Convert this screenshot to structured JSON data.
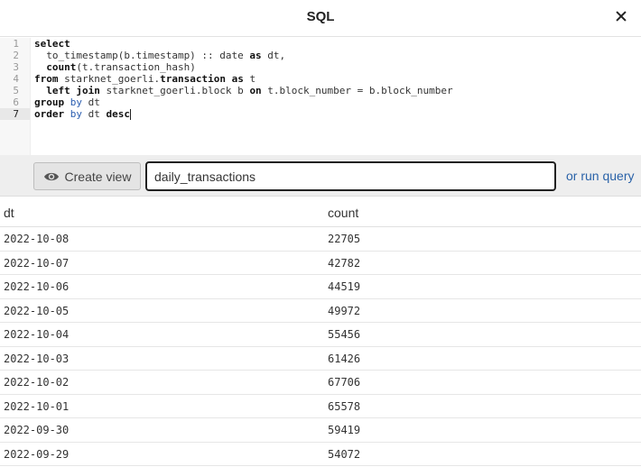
{
  "dialog": {
    "title": "SQL"
  },
  "editor": {
    "line_numbers": [
      "1",
      "2",
      "3",
      "4",
      "5",
      "6",
      "7"
    ],
    "active_line": 7
  },
  "toolbar": {
    "create_view_label": "Create view",
    "view_name_value": "daily_transactions",
    "run_query_label": "or run query"
  },
  "results": {
    "columns": [
      "dt",
      "count"
    ],
    "rows": [
      [
        "2022-10-08",
        "22705"
      ],
      [
        "2022-10-07",
        "42782"
      ],
      [
        "2022-10-06",
        "44519"
      ],
      [
        "2022-10-05",
        "49972"
      ],
      [
        "2022-10-04",
        "55456"
      ],
      [
        "2022-10-03",
        "61426"
      ],
      [
        "2022-10-02",
        "67706"
      ],
      [
        "2022-10-01",
        "65578"
      ],
      [
        "2022-09-30",
        "59419"
      ],
      [
        "2022-09-29",
        "54072"
      ]
    ]
  },
  "code": {
    "l1_kw": "select",
    "l2_text": "  to_timestamp(b.timestamp) :: date ",
    "l2_kw": "as",
    "l2_tail": " dt,",
    "l3_kw": "  count",
    "l3_tail": "(t.transaction_hash)",
    "l4_kw": "from",
    "l4_text": " starknet_goerli.",
    "l4_kw2": "transaction",
    "l4_as": " as",
    "l4_tail": " t",
    "l5_kw": "  left join",
    "l5_text": " starknet_goerli.block b ",
    "l5_on": "on",
    "l5_tail": " t.block_number = b.block_number",
    "l6_kw": "group",
    "l6_by": " by",
    "l6_tail": " dt",
    "l7_kw": "order",
    "l7_by": " by",
    "l7_tail": " dt ",
    "l7_desc": "desc"
  }
}
